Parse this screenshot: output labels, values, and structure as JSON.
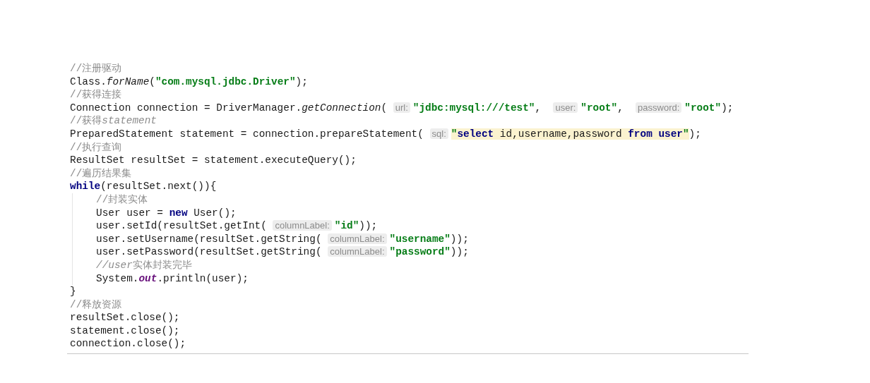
{
  "code_lines": [
    {
      "tokens": [
        {
          "kind": "comment",
          "text": "//注册驱动"
        }
      ]
    },
    {
      "tokens": [
        {
          "kind": "code",
          "text": "Class."
        },
        {
          "kind": "method_italic",
          "text": "forName"
        },
        {
          "kind": "code",
          "text": "("
        },
        {
          "kind": "string",
          "text": "\"com.mysql.jdbc.Driver\""
        },
        {
          "kind": "code",
          "text": ");"
        }
      ]
    },
    {
      "tokens": [
        {
          "kind": "comment",
          "text": "//获得连接"
        }
      ]
    },
    {
      "tokens": [
        {
          "kind": "code",
          "text": "Connection connection = DriverManager."
        },
        {
          "kind": "method_italic",
          "text": "getConnection"
        },
        {
          "kind": "code",
          "text": "( "
        },
        {
          "kind": "hint",
          "text": "url:"
        },
        {
          "kind": "string",
          "text": "\"jdbc:mysql:///test\""
        },
        {
          "kind": "code",
          "text": ",  "
        },
        {
          "kind": "hint",
          "text": "user:"
        },
        {
          "kind": "string",
          "text": "\"root\""
        },
        {
          "kind": "code",
          "text": ",  "
        },
        {
          "kind": "hint",
          "text": "password:"
        },
        {
          "kind": "string",
          "text": "\"root\""
        },
        {
          "kind": "code",
          "text": ");"
        }
      ]
    },
    {
      "tokens": [
        {
          "kind": "comment",
          "text": "//获得"
        },
        {
          "kind": "comment_italic",
          "text": "statement"
        }
      ]
    },
    {
      "tokens": [
        {
          "kind": "code",
          "text": "PreparedStatement statement = connection.prepareStatement( "
        },
        {
          "kind": "hint",
          "text": "sql:"
        },
        {
          "kind": "string",
          "text": "\""
        },
        {
          "kind": "sql_keyword",
          "text": "select"
        },
        {
          "kind": "sql_text",
          "text": " id,username,password "
        },
        {
          "kind": "sql_keyword",
          "text": "from user"
        },
        {
          "kind": "string",
          "text": "\""
        },
        {
          "kind": "code",
          "text": ");"
        }
      ]
    },
    {
      "tokens": [
        {
          "kind": "comment",
          "text": "//执行查询"
        }
      ]
    },
    {
      "tokens": [
        {
          "kind": "code",
          "text": "ResultSet resultSet = statement.executeQuery();"
        }
      ]
    },
    {
      "tokens": [
        {
          "kind": "comment",
          "text": "//遍历结果集"
        }
      ]
    },
    {
      "tokens": [
        {
          "kind": "keyword",
          "text": "while"
        },
        {
          "kind": "code",
          "text": "(resultSet.next()){"
        }
      ],
      "children": [
        {
          "tokens": [
            {
              "kind": "comment",
              "text": "//封装实体"
            }
          ]
        },
        {
          "tokens": [
            {
              "kind": "code",
              "text": "User user = "
            },
            {
              "kind": "keyword",
              "text": "new"
            },
            {
              "kind": "code",
              "text": " User();"
            }
          ]
        },
        {
          "tokens": [
            {
              "kind": "code",
              "text": "user.setId(resultSet.getInt( "
            },
            {
              "kind": "hint",
              "text": "columnLabel:"
            },
            {
              "kind": "string",
              "text": "\"id\""
            },
            {
              "kind": "code",
              "text": "));"
            }
          ]
        },
        {
          "tokens": [
            {
              "kind": "code",
              "text": "user.setUsername(resultSet.getString( "
            },
            {
              "kind": "hint",
              "text": "columnLabel:"
            },
            {
              "kind": "string",
              "text": "\"username\""
            },
            {
              "kind": "code",
              "text": "));"
            }
          ]
        },
        {
          "tokens": [
            {
              "kind": "code",
              "text": "user.setPassword(resultSet.getString( "
            },
            {
              "kind": "hint",
              "text": "columnLabel:"
            },
            {
              "kind": "string",
              "text": "\"password\""
            },
            {
              "kind": "code",
              "text": "));"
            }
          ]
        },
        {
          "tokens": [
            {
              "kind": "comment_italic",
              "text": "//user"
            },
            {
              "kind": "comment",
              "text": "实体封装完毕"
            }
          ]
        },
        {
          "tokens": [
            {
              "kind": "code",
              "text": "System."
            },
            {
              "kind": "field",
              "text": "out"
            },
            {
              "kind": "code",
              "text": ".println(user);"
            }
          ]
        }
      ]
    },
    {
      "tokens": [
        {
          "kind": "code",
          "text": "}"
        }
      ]
    },
    {
      "tokens": [
        {
          "kind": "comment",
          "text": "//释放资源"
        }
      ]
    },
    {
      "tokens": [
        {
          "kind": "code",
          "text": "resultSet.close();"
        }
      ]
    },
    {
      "tokens": [
        {
          "kind": "code",
          "text": "statement.close();"
        }
      ]
    },
    {
      "tokens": [
        {
          "kind": "code",
          "text": "connection.close();"
        }
      ]
    }
  ]
}
